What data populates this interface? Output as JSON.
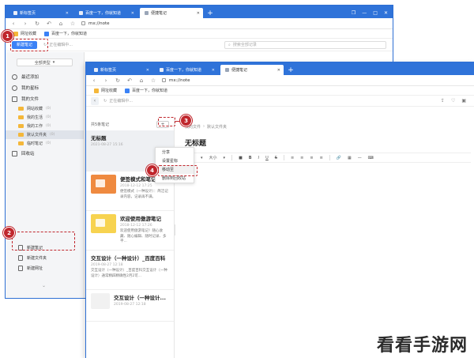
{
  "tabs": [
    {
      "label": "新标签页",
      "active": false
    },
    {
      "label": "百度一下，你就知道",
      "active": false
    },
    {
      "label": "便捷笔记",
      "active": true
    }
  ],
  "address": {
    "url": "mx://note"
  },
  "favorites": [
    {
      "label": "网址收藏",
      "color": "#f4b73a"
    },
    {
      "label": "百度一下，你就知道",
      "color": "#3b82f6"
    }
  ],
  "toolbar": {
    "new_note": "新建笔记",
    "sync_status": "正在编辑中...",
    "search_placeholder": "搜索全部记录"
  },
  "sidebar": {
    "type_select": "全部类型",
    "items": [
      {
        "label": "最近添加"
      },
      {
        "label": "我的星标"
      },
      {
        "label": "我的文件"
      }
    ],
    "folders": [
      {
        "label": "网站收藏",
        "count": "(0)"
      },
      {
        "label": "我的生活",
        "count": "(0)"
      },
      {
        "label": "我的工作",
        "count": "(0)"
      },
      {
        "label": "默认文件夹",
        "count": "(0)"
      },
      {
        "label": "临时笔记",
        "count": "(0)"
      }
    ],
    "recycle": "回收站",
    "new_menu": [
      "新建笔记",
      "新建文件夹",
      "新建网址"
    ]
  },
  "front": {
    "sync_status": "正在编辑中...",
    "list_header": "共5条笔记",
    "add_button": "+",
    "notes": [
      {
        "title": "无标题",
        "date": "2021-08-27  15:16",
        "snippet": ""
      },
      {
        "title": "便签模式和笔记模",
        "date": "2018-12-12  17:25",
        "snippet": "便签模式（一种设计）：简洁记录内容，记录再不满。"
      },
      {
        "title": "欢迎使用傲游笔记",
        "date": "2018-12-12  17:26",
        "snippet": "欢迎使用傲游笔记！随心收藏、随心编辑、随时记录、多平..."
      },
      {
        "title": "交互设计（一种设计）_百度百科",
        "date": "2019-08-27  12:18",
        "snippet": "交互设计（一种设计）_百度百科交互设计（一种设计）通常精辟精确性2月2可..."
      },
      {
        "title": "交互设计（一种设计...",
        "date": "2019-08-27  12:18",
        "snippet": ""
      }
    ],
    "breadcrumb": [
      "我的文件",
      "默认文件夹"
    ],
    "editor_title": "无标题",
    "format_tools": [
      "字体",
      "大小",
      "B",
      "I",
      "U",
      "S",
      "≡",
      "≡",
      "≡",
      "≡",
      "🔗",
      "▦",
      "—",
      "⌨"
    ]
  },
  "context_menu": [
    "分享",
    "设置星标",
    "移动至",
    "删除到回收站"
  ],
  "steps": [
    "1",
    "2",
    "3",
    "4"
  ],
  "watermark": "看看手游网"
}
